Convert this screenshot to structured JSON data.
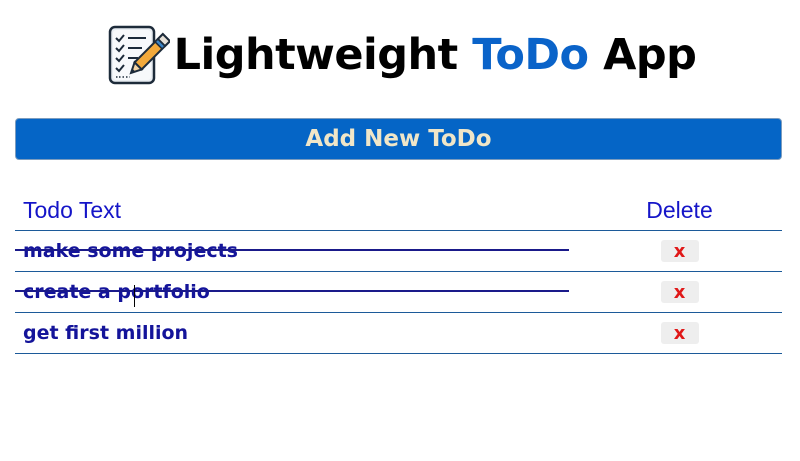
{
  "header": {
    "logo_icon": "notepad-pencil-icon",
    "title_part1": "Lightweight ",
    "title_accent": "ToDo",
    "title_part2": " App",
    "accent_color": "#0a63c9"
  },
  "add_button": {
    "label": "Add New ToDo",
    "color": "#0565c6"
  },
  "table": {
    "headers": {
      "text": "Todo Text",
      "delete": "Delete"
    },
    "rows": [
      {
        "text": "make some projects",
        "completed": true,
        "delete_label": "x"
      },
      {
        "text": "create a portfolio",
        "completed": true,
        "delete_label": "x"
      },
      {
        "text": "get first million",
        "completed": false,
        "delete_label": "x"
      }
    ]
  }
}
